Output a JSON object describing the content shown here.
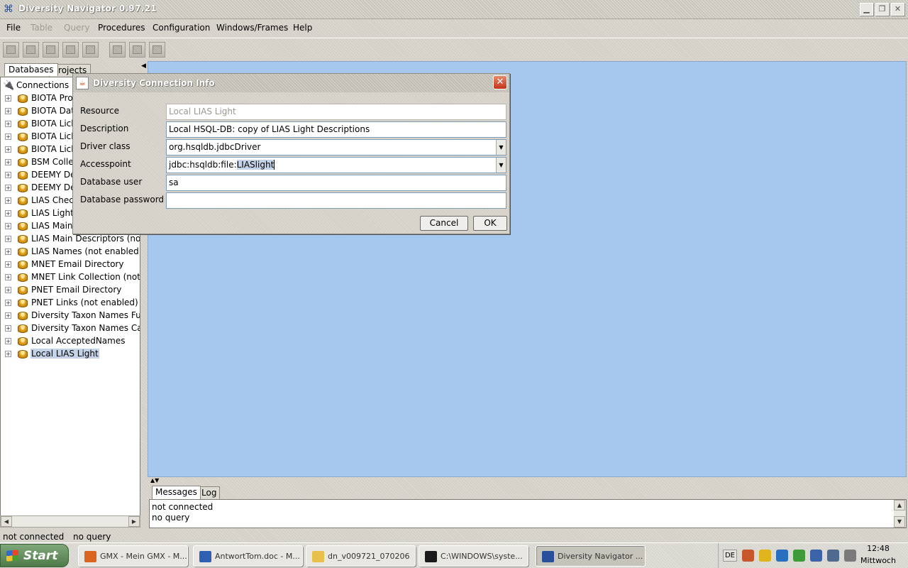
{
  "window": {
    "title": "Diversity Navigator 0.97.21",
    "app_icon": "network-app-icon",
    "controls": [
      "minimize-icon",
      "restore-icon",
      "close-icon"
    ]
  },
  "menubar": {
    "items": [
      {
        "label": "File",
        "enabled": true
      },
      {
        "label": "Table",
        "enabled": false
      },
      {
        "label": "Query",
        "enabled": false
      },
      {
        "label": "Procedures",
        "enabled": true
      },
      {
        "label": "Configuration",
        "enabled": true
      },
      {
        "label": "Windows/Frames",
        "enabled": true
      },
      {
        "label": "Help",
        "enabled": true
      }
    ]
  },
  "left_panel": {
    "tabs": [
      "Databases",
      "Projects"
    ],
    "root_label": "Connections",
    "connections": [
      "BIOTA Pro",
      "BIOTA Dat",
      "BIOTA Lich",
      "BIOTA Lich",
      "BIOTA Lich",
      "BSM Collec",
      "DEEMY De",
      "DEEMY De",
      "LIAS Chec",
      "LIAS Light",
      "LIAS Main",
      "LIAS Main Descriptors (not e",
      "LIAS Names (not enabled)",
      "MNET Email Directory",
      "MNET Link Collection (not e",
      "PNET Email Directory",
      "PNET Links (not enabled)",
      "Diversity Taxon Names Fung",
      "Diversity Taxon Names Cach",
      "Local AcceptedNames",
      "Local LIAS Light"
    ],
    "selected_connection": "Local LIAS Light"
  },
  "messages": {
    "tabs": [
      "Messages",
      "Log"
    ],
    "lines": [
      "not connected",
      "no query"
    ]
  },
  "statusbar": {
    "connection": "not connected",
    "query": "no query"
  },
  "dialog": {
    "title": "Diversity Connection Info",
    "fields": {
      "resource": {
        "label": "Resource",
        "value": "Local LIAS Light"
      },
      "description": {
        "label": "Description",
        "value": "Local HSQL-DB: copy of LIAS Light Descriptions"
      },
      "driver_class": {
        "label": "Driver class",
        "value": "org.hsqldb.jdbcDriver"
      },
      "accesspoint": {
        "label": "Accesspoint",
        "value_prefix": "jdbc:hsqldb:file:",
        "value_selected": "LIASlight"
      },
      "db_user": {
        "label": "Database user",
        "value": "sa"
      },
      "db_password": {
        "label": "Database password",
        "value": ""
      }
    },
    "cancel_label": "Cancel",
    "ok_label": "OK"
  },
  "taskbar": {
    "start_label": "Start",
    "tasks": [
      {
        "label": "GMX - Mein GMX - M...",
        "icon": "firefox-icon",
        "color": "#d9651f"
      },
      {
        "label": "AntwortTom.doc - M...",
        "icon": "word-doc-icon",
        "color": "#2f5fb3"
      },
      {
        "label": "dn_v009721_070206",
        "icon": "folder-icon",
        "color": "#e7c04b"
      },
      {
        "label": "C:\\WINDOWS\\syste...",
        "icon": "console-icon",
        "color": "#1a1a1a"
      },
      {
        "label": "Diversity Navigator ...",
        "icon": "network-app-icon",
        "color": "#2a4f9a",
        "active": true
      }
    ],
    "tray": {
      "language": "DE",
      "icons": [
        {
          "name": "back-arrow-icon",
          "color": "#c7572b"
        },
        {
          "name": "security-shield-icon",
          "color": "#e0b41d"
        },
        {
          "name": "search-magnifier-icon",
          "color": "#2a6ec0"
        },
        {
          "name": "network-globe-icon",
          "color": "#3f9b3a"
        },
        {
          "name": "bars-icon",
          "color": "#3c62a8"
        },
        {
          "name": "monitor-icon",
          "color": "#4f6a8d"
        },
        {
          "name": "speaker-icon",
          "color": "#7a7a7a"
        }
      ],
      "time": "12:48",
      "day": "Mittwoch"
    }
  }
}
